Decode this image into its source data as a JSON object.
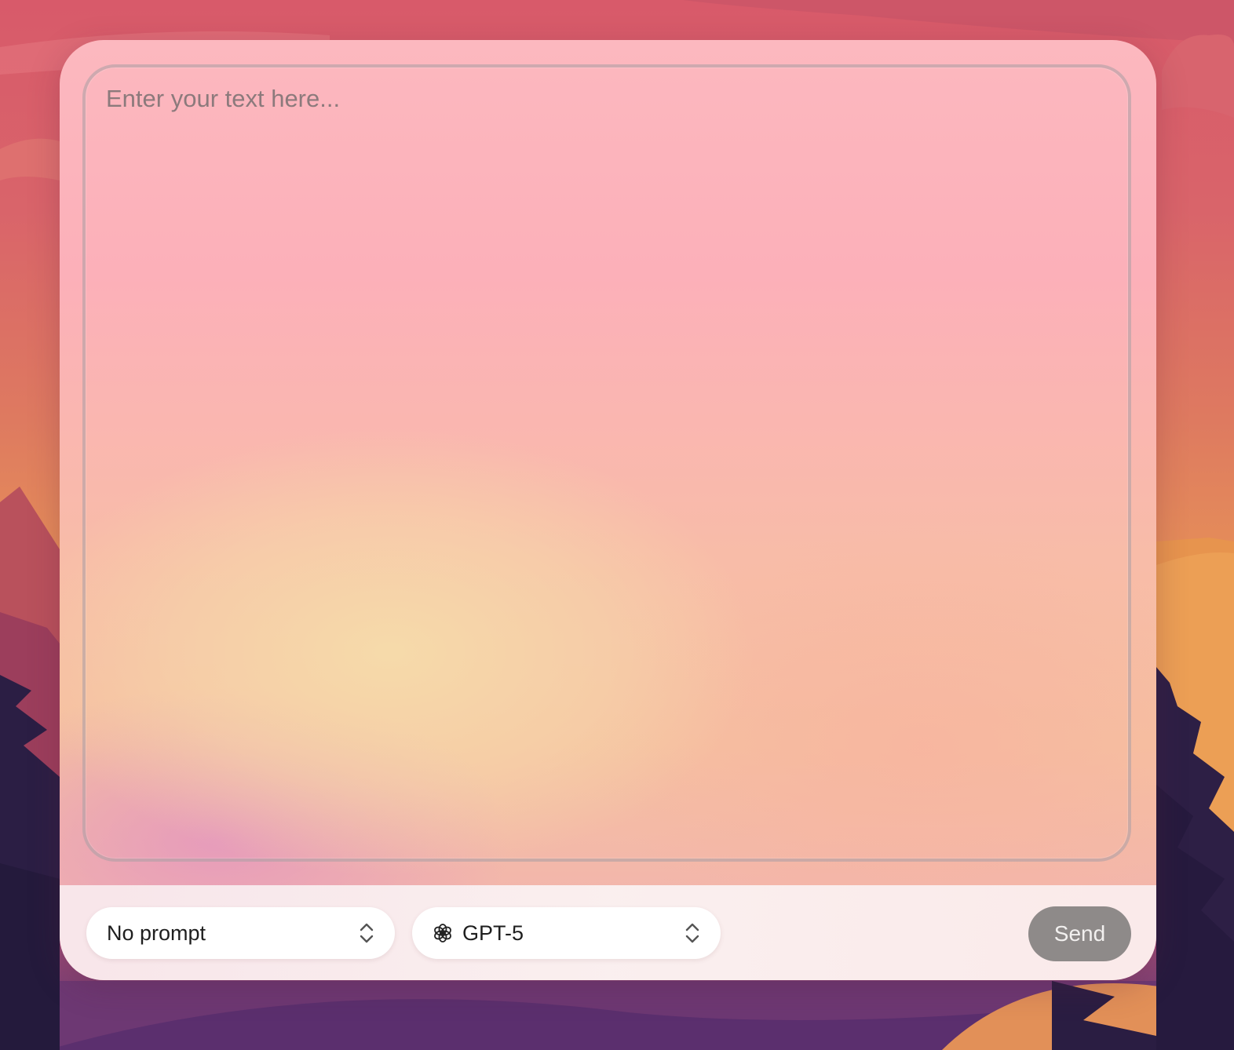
{
  "editor": {
    "placeholder": "Enter your text here..."
  },
  "toolbar": {
    "prompt_select": {
      "value": "No prompt",
      "icon": "chevron-up-down-icon"
    },
    "model_select": {
      "value": "GPT-5",
      "leading_icon": "openai-icon",
      "icon": "chevron-up-down-icon"
    },
    "send_label": "Send"
  },
  "colors": {
    "send_button_bg": "#8e8a89",
    "send_button_text": "#f2f0ef",
    "panel_top": "#fcb8bf",
    "panel_mid": "#f5c0a0",
    "background_top": "#d85a6a",
    "background_bottom": "#5a3170"
  }
}
